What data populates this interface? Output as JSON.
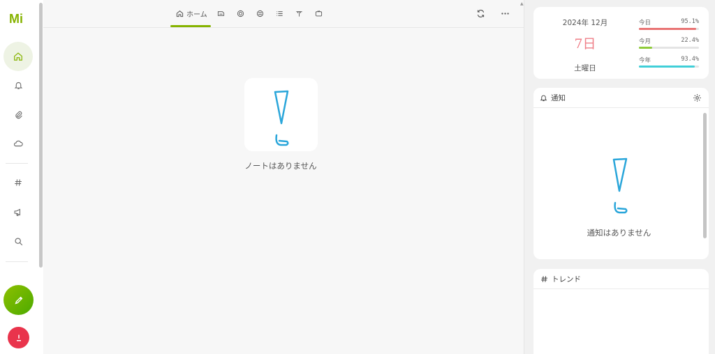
{
  "nav": {
    "logo_text": "Mi",
    "items": [
      {
        "name": "home",
        "icon": "home-icon",
        "active": true
      },
      {
        "name": "notifications",
        "icon": "bell-icon",
        "active": false
      },
      {
        "name": "clips",
        "icon": "paperclip-icon",
        "active": false
      },
      {
        "name": "drive",
        "icon": "cloud-icon",
        "active": false
      },
      {
        "name": "hashtags",
        "icon": "hash-icon",
        "active": false
      },
      {
        "name": "announcements",
        "icon": "megaphone-icon",
        "active": false
      },
      {
        "name": "search",
        "icon": "search-icon",
        "active": false
      }
    ],
    "post_icon": "pencil-icon",
    "update_icon": "download-icon"
  },
  "main": {
    "tabs": [
      {
        "label": "ホーム",
        "icon": "home-icon",
        "active": true
      },
      {
        "label": "",
        "icon": "local-timeline-icon"
      },
      {
        "label": "",
        "icon": "social-timeline-icon"
      },
      {
        "label": "",
        "icon": "global-timeline-icon"
      },
      {
        "label": "",
        "icon": "list-icon"
      },
      {
        "label": "",
        "icon": "antenna-icon"
      },
      {
        "label": "",
        "icon": "channel-icon"
      }
    ],
    "refresh_icon": "refresh-icon",
    "more_icon": "more-icon",
    "empty_text": "ノートはありません"
  },
  "calendar": {
    "date": "2024年 12月",
    "day": "7日",
    "weekday": "土曜日",
    "stats": [
      {
        "label": "今日",
        "percent": "95.1%",
        "value": 0.951,
        "color": "#e97373"
      },
      {
        "label": "今月",
        "percent": "22.4%",
        "value": 0.224,
        "color": "#8fcb3a"
      },
      {
        "label": "今年",
        "percent": "93.4%",
        "value": 0.934,
        "color": "#41cfd8"
      }
    ]
  },
  "notifications": {
    "title": "通知",
    "empty_text": "通知はありません",
    "settings_icon": "gear-icon"
  },
  "trends": {
    "title": "トレンド",
    "icon": "hash-icon"
  },
  "colors": {
    "accent": "#86b300",
    "empty_illustration": "#2aa6da",
    "danger": "#e9344c"
  }
}
